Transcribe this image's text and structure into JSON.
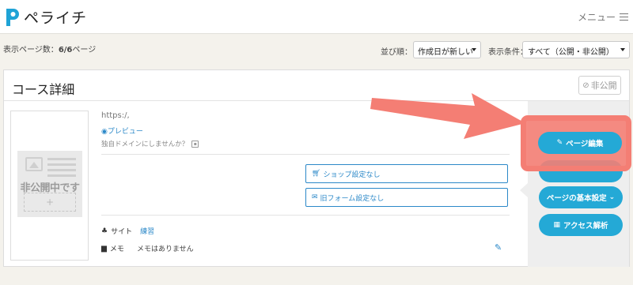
{
  "header": {
    "logo_text": "ペライチ",
    "menu_label": "メニュー"
  },
  "toolbar": {
    "page_count_prefix": "表示ページ数：",
    "page_count_value": "6/6",
    "page_count_suffix": "ページ",
    "sort_label": "並び順：",
    "sort_value": "作成日が新しい",
    "filter_label": "表示条件：",
    "filter_value": "すべて（公開・非公開）"
  },
  "card": {
    "title": "コース詳細",
    "private_badge": "非公開",
    "thumbnail_label": "非公開中です",
    "thumbnail_plus": "+",
    "url": "https:/,",
    "preview_label": "プレビュー",
    "domain_note": "独自ドメインにしませんか？",
    "shop_button": "ショップ設定なし",
    "form_button": "旧フォーム設定なし",
    "site_label": "サイト",
    "site_value": "練習",
    "memo_label": "メモ",
    "memo_value": "メモはありません"
  },
  "actions": {
    "edit_page": "ページ編集",
    "basic_settings": "ページの基本設定",
    "access_analysis": "アクセス解析"
  },
  "colors": {
    "accent": "#24a9d6",
    "link": "#2b88c8",
    "annotation": "#f47e74"
  }
}
